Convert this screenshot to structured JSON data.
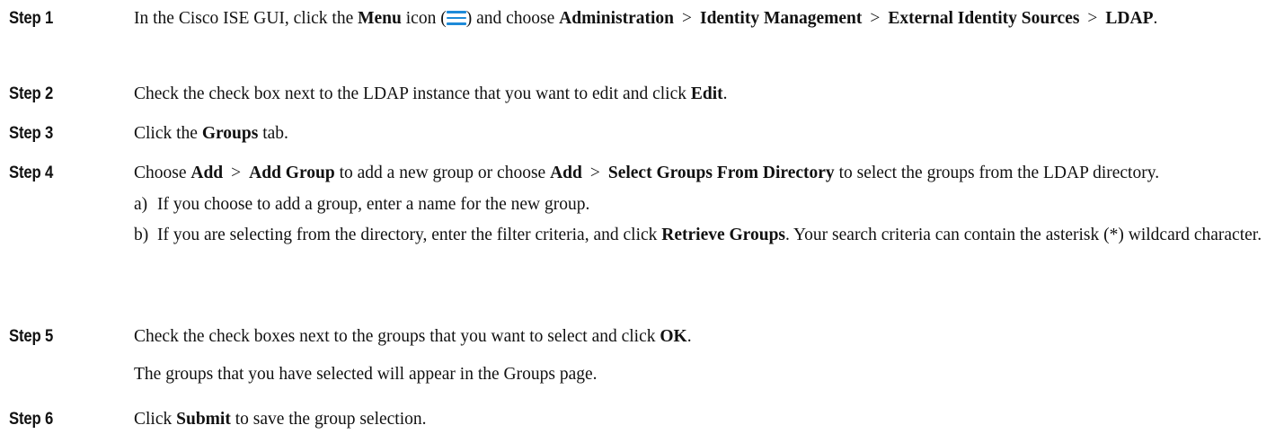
{
  "steps": [
    {
      "label": "Step 1",
      "t1": "In the Cisco ISE GUI, click the ",
      "b1": "Menu",
      "t2": " icon (",
      "icon": "menu-icon",
      "t3": ") and choose ",
      "b2": "Administration",
      "sep1": ">",
      "b3": "Identity Management",
      "sep2": ">",
      "b4": "External Identity Sources",
      "sep3": ">",
      "b5": "LDAP",
      "t4": "."
    },
    {
      "label": "Step 2",
      "t1": "Check the check box next to the LDAP instance that you want to edit and click ",
      "b1": "Edit",
      "t2": "."
    },
    {
      "label": "Step 3",
      "t1": "Click the ",
      "b1": "Groups",
      "t2": " tab."
    },
    {
      "label": "Step 4",
      "t1": "Choose ",
      "b1": "Add",
      "sep1": ">",
      "b2": "Add Group",
      "t2": " to add a new group or choose ",
      "b3": "Add",
      "sep2": ">",
      "b4": "Select Groups From Directory",
      "t3": " to select the groups from the LDAP directory.",
      "substeps": [
        {
          "marker": "a)",
          "t1": "If you choose to add a group, enter a name for the new group."
        },
        {
          "marker": "b)",
          "t1": "If you are selecting from the directory, enter the filter criteria, and click ",
          "b1": "Retrieve Groups",
          "t2": ". Your search criteria can contain the asterisk (*) wildcard character."
        }
      ]
    },
    {
      "label": "Step 5",
      "t1": "Check the check boxes next to the groups that you want to select and click ",
      "b1": "OK",
      "t2": ".",
      "result": "The groups that you have selected will appear in the Groups page."
    },
    {
      "label": "Step 6",
      "t1": "Click ",
      "b1": "Submit",
      "t2": " to save the group selection."
    }
  ],
  "colors": {
    "text": "#111111",
    "menu_icon": "#1d8ad8"
  }
}
